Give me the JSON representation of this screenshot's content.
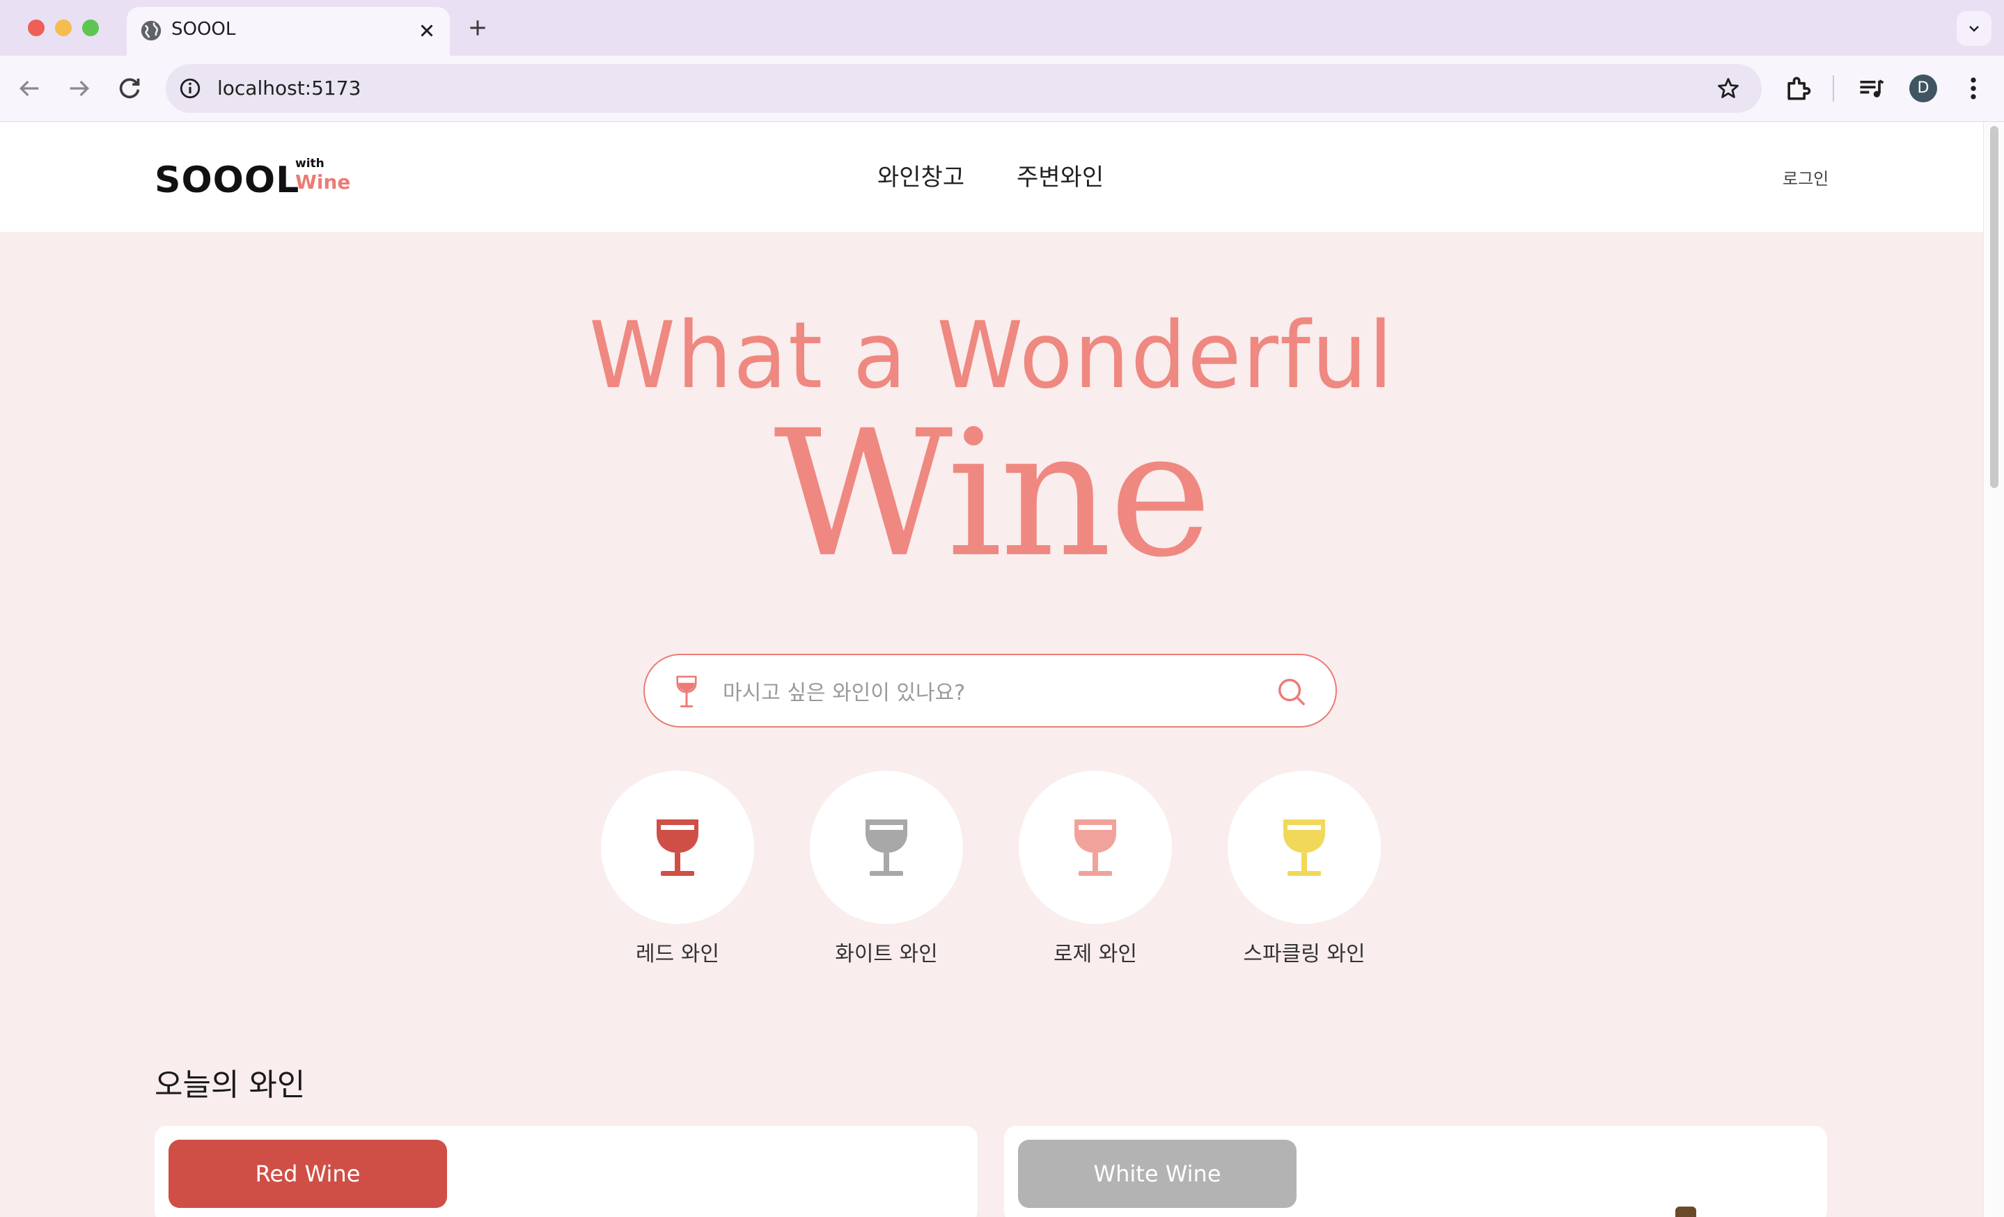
{
  "browser": {
    "tab_title": "SOOOL",
    "url": "localhost:5173",
    "avatar_initial": "D"
  },
  "header": {
    "logo_main": "SOOOL",
    "logo_with": "with",
    "logo_wine": "Wine",
    "nav": [
      "와인창고",
      "주변와인"
    ],
    "login": "로그인"
  },
  "hero": {
    "line1": "What a Wonderful",
    "line2": "Wine"
  },
  "search": {
    "placeholder": "마시고 싶은 와인이 있나요?"
  },
  "categories": [
    {
      "label": "레드 와인",
      "color": "#cf4f47"
    },
    {
      "label": "화이트 와인",
      "color": "#a8a8a8"
    },
    {
      "label": "로제 와인",
      "color": "#f1a29b"
    },
    {
      "label": "스파클링 와인",
      "color": "#f2d85a"
    }
  ],
  "todays_wine": {
    "title": "오늘의 와인",
    "cards": [
      {
        "label": "Red Wine",
        "color": "#cf4f47"
      },
      {
        "label": "White Wine",
        "color": "#b3b3b3"
      }
    ]
  },
  "colors": {
    "accent": "#ec7b75",
    "page_bg": "#f9eded"
  }
}
